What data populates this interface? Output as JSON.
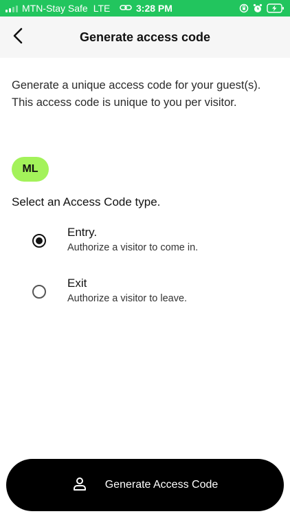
{
  "status_bar": {
    "carrier": "MTN-Stay Safe",
    "network": "LTE",
    "time": "3:28 PM"
  },
  "header": {
    "title": "Generate access code",
    "back_icon": "chevron-left-icon"
  },
  "intro_text": "Generate a unique access code for your guest(s). This access code is unique to you per visitor.",
  "avatar_initials": "ML",
  "select_label": "Select an Access Code type.",
  "options": [
    {
      "title": "Entry.",
      "subtitle": "Authorize a visitor to come in.",
      "selected": true
    },
    {
      "title": "Exit",
      "subtitle": "Authorize a visitor to leave.",
      "selected": false
    }
  ],
  "cta": {
    "label": "Generate Access Code",
    "icon": "user-icon"
  },
  "colors": {
    "status_bar": "#22c55e",
    "header_bg": "#f6f6f6",
    "chip": "#a3f25a",
    "cta_bg": "#000000"
  }
}
